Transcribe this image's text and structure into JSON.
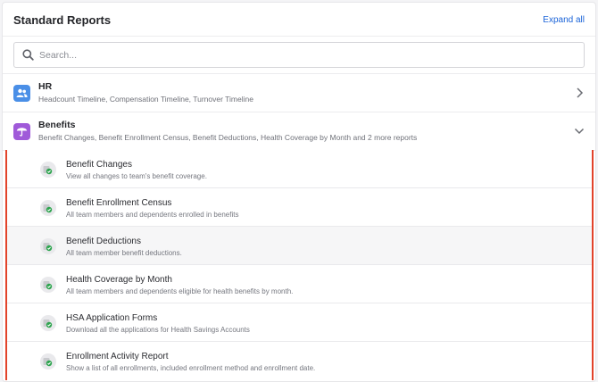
{
  "header": {
    "title": "Standard Reports",
    "expand_all": "Expand all"
  },
  "search": {
    "placeholder": "Search..."
  },
  "categories": [
    {
      "title": "HR",
      "subtitle": "Headcount Timeline, Compensation Timeline, Turnover Timeline",
      "icon": "people-icon",
      "color": "#4a8fe7",
      "state": "collapsed"
    },
    {
      "title": "Benefits",
      "subtitle": "Benefit Changes, Benefit Enrollment Census, Benefit Deductions, Health Coverage by Month and 2 more reports",
      "icon": "umbrella-icon",
      "color": "#a05ad9",
      "state": "expanded"
    }
  ],
  "reports": [
    {
      "title": "Benefit Changes",
      "subtitle": "View all changes to team's benefit coverage."
    },
    {
      "title": "Benefit Enrollment Census",
      "subtitle": "All team members and dependents enrolled in benefits"
    },
    {
      "title": "Benefit Deductions",
      "subtitle": "All team member benefit deductions."
    },
    {
      "title": "Health Coverage by Month",
      "subtitle": "All team members and dependents eligible for health benefits by month."
    },
    {
      "title": "HSA Application Forms",
      "subtitle": "Download all the applications for Health Savings Accounts"
    },
    {
      "title": "Enrollment Activity Report",
      "subtitle": "Show a list of all enrollments, included enrollment method and enrollment date."
    }
  ],
  "colors": {
    "accent": "#1a63d8",
    "highlight": "#e2432b",
    "report_icon_badge": "#2ea44f"
  }
}
